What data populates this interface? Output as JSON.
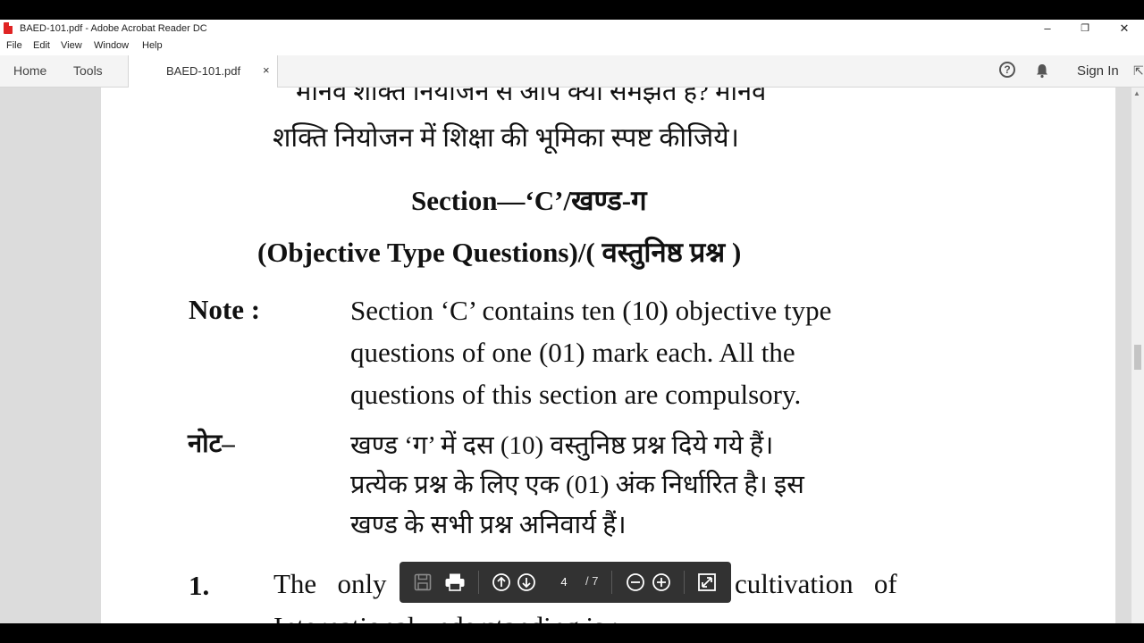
{
  "window": {
    "title": "BAED-101.pdf - Adobe Acrobat Reader DC",
    "minimize": "–",
    "restore": "❐",
    "close": "✕"
  },
  "menu": [
    "File",
    "Edit",
    "View",
    "Window",
    "Help"
  ],
  "toolbar": {
    "home": "Home",
    "tools": "Tools",
    "doc_tab": "BAED-101.pdf",
    "doc_tab_close": "×",
    "help": "?",
    "sign_in": "Sign In"
  },
  "document": {
    "line_top_partial": "मानव शक्ति नियोजन  से आप क्या समझते हैं? मानव",
    "line_top": "शक्ति नियोजन में शिक्षा की भूमिका स्पष्ट कीजिये।",
    "section_heading": "Section—‘C’/खण्ड-ग",
    "section_subheading": "(Objective Type Questions)/( वस्तुनिष्ठ प्रश्न )",
    "note_label": "Note :",
    "note_lines": [
      "Section ‘C’ contains ten (10) objective type",
      "questions of one (01) mark each. All the",
      "questions of this section are compulsory."
    ],
    "hindi_note_label": "नोट–",
    "hindi_note_lines": [
      "खण्ड ‘ग’ में दस (10) वस्तुनिष्ठ प्रश्न दिये गये हैं।",
      "प्रत्येक प्रश्न के लिए एक (01) अंक निर्धारित है। इस",
      "खण्ड के सभी प्रश्न अनिवार्य हैं।"
    ],
    "question_number": "1.",
    "question_start": "The   only",
    "question_end": "cultivation   of",
    "question_next_partial": "International understanding is :"
  },
  "floating_toolbar": {
    "current_page": "4",
    "total_pages": "/ 7"
  }
}
